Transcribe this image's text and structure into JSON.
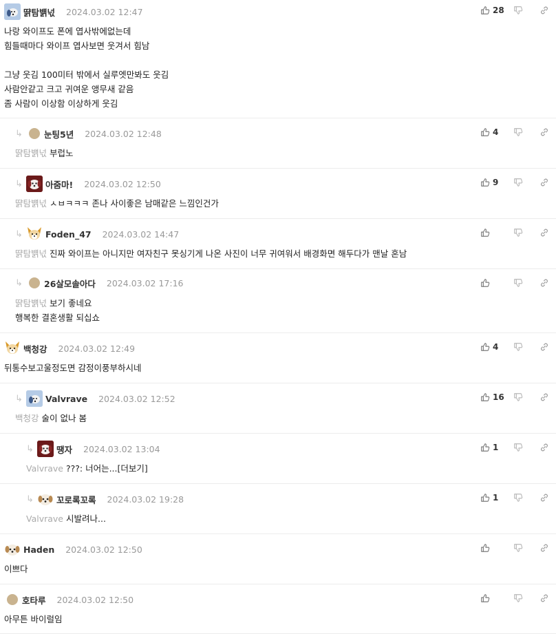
{
  "comments": [
    {
      "nick": "땱탐뱱넋",
      "date": "2024.03.02 12:47",
      "likes": "28",
      "lines": [
        "나랑 와이프도 폰에 엽사밖에없는데",
        "힘들때마다 와이프 엽사보면 웃겨서 힘남",
        "",
        "그냥 웃김 100미터 밖에서 실루엣만봐도 웃김",
        "사람안같고 크고 귀여운 앵무새 같음",
        "좀 사람이 이상함 이상하게 웃김"
      ],
      "avatar": "dog-blue-icon"
    },
    {
      "nick": "눈팅5년",
      "date": "2024.03.02 12:48",
      "likes": "4",
      "mention": "땱탐뱱넋",
      "text": "부럽노",
      "avatar": "dot-avatar"
    },
    {
      "nick": "아줌마!",
      "date": "2024.03.02 12:50",
      "likes": "9",
      "mention": "땱탐뱱넋",
      "text": "ㅅㅂㅋㅋㅋ 존나 사이좋은 남매같은 느낌인건가",
      "avatar": "dog-red-icon"
    },
    {
      "nick": "Foden_47",
      "date": "2024.03.02 14:47",
      "likes": "",
      "mention": "땱탐뱱넋",
      "text": "진짜 와이프는 아니지만 여자친구 못싱기게 나온 사진이 너무 귀여워서 배경화면 해두다가 맨날 혼남",
      "avatar": "fox-icon"
    },
    {
      "nick": "26살모솔아다",
      "date": "2024.03.02 17:16",
      "likes": "",
      "mention": "땱탐뱱넋",
      "text": "보기 좋네요",
      "text2": "행복한 결혼생활 되십쇼",
      "avatar": "dot-avatar"
    },
    {
      "nick": "백청강",
      "date": "2024.03.02 12:49",
      "likes": "4",
      "text": "뒤통수보고울정도면 감정이풍부하시네",
      "avatar": "fox-icon"
    },
    {
      "nick": "Valvrave",
      "date": "2024.03.02 12:52",
      "likes": "16",
      "mention": "백청강",
      "text": "술이 없나 봄",
      "avatar": "dog-blue-icon"
    },
    {
      "nick": "땡자",
      "date": "2024.03.02 13:04",
      "likes": "1",
      "mention": "Valvrave",
      "text": "???: 너어는...[더보기]",
      "avatar": "dog-red-icon"
    },
    {
      "nick": "꼬로록꼬록",
      "date": "2024.03.02 19:28",
      "likes": "1",
      "mention": "Valvrave",
      "text": "시발려나...",
      "avatar": "puppy-icon"
    },
    {
      "nick": "Haden",
      "date": "2024.03.02 12:50",
      "likes": "",
      "text": "이쁘다",
      "avatar": "puppy-icon"
    },
    {
      "nick": "호타루",
      "date": "2024.03.02 12:50",
      "likes": "",
      "text": "아무튼 바이럴임",
      "avatar": "dot-avatar"
    }
  ],
  "icons": {
    "like": "thumbs-up-icon",
    "dislike": "thumbs-down-icon",
    "link": "link-icon",
    "reply": "reply-arrow-icon"
  }
}
